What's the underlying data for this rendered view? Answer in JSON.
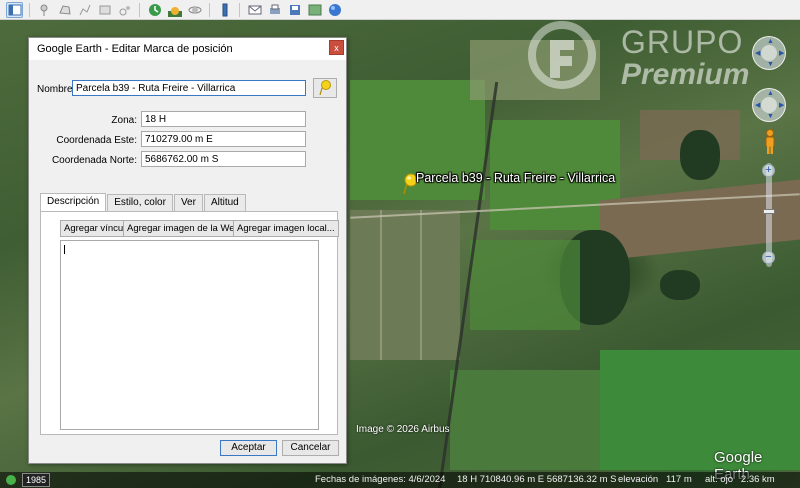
{
  "toolbar": {
    "icons": [
      "sidebar-toggle-icon",
      "add-placemark-icon",
      "add-polygon-icon",
      "add-path-icon",
      "add-image-overlay-icon",
      "record-tour-icon",
      "historical-imagery-icon",
      "sunlight-icon",
      "planets-icon",
      "ruler-icon",
      "email-icon",
      "print-icon",
      "save-image-icon",
      "view-in-maps-icon",
      "earth-icon"
    ]
  },
  "dialog": {
    "title": "Google Earth - Editar Marca de posición",
    "close": "x",
    "name_label": "Nombre:",
    "name_value": "Parcela b39 - Ruta Freire - Villarrica",
    "zone_label": "Zona:",
    "zone_value": "18 H",
    "east_label": "Coordenada Este:",
    "east_value": "710279.00 m E",
    "north_label": "Coordenada Norte:",
    "north_value": "5686762.00 m S",
    "tabs": [
      {
        "label": "Descripción"
      },
      {
        "label": "Estilo, color"
      },
      {
        "label": "Ver"
      },
      {
        "label": "Altitud"
      }
    ],
    "add_link": "Agregar vínculo",
    "add_web_image": "Agregar imagen de la Web...",
    "add_local_image": "Agregar imagen local...",
    "description": "",
    "accept": "Aceptar",
    "cancel": "Cancelar"
  },
  "map": {
    "placemark_label": "Parcela b39 - Ruta Freire - Villarrica",
    "watermark_line1": "GRUPO",
    "watermark_line2": "Premium",
    "copyright": "Image © 2026 Airbus",
    "logo": "Google Earth"
  },
  "statusbar": {
    "year": "1985",
    "imagery_date": "Fechas de imágenes: 4/6/2024",
    "coordinates": "18 H 710840.96 m E 5687136.32 m S",
    "elevation": "elevación   117 m",
    "eye_alt": "alt. ojo   2.36 km"
  }
}
